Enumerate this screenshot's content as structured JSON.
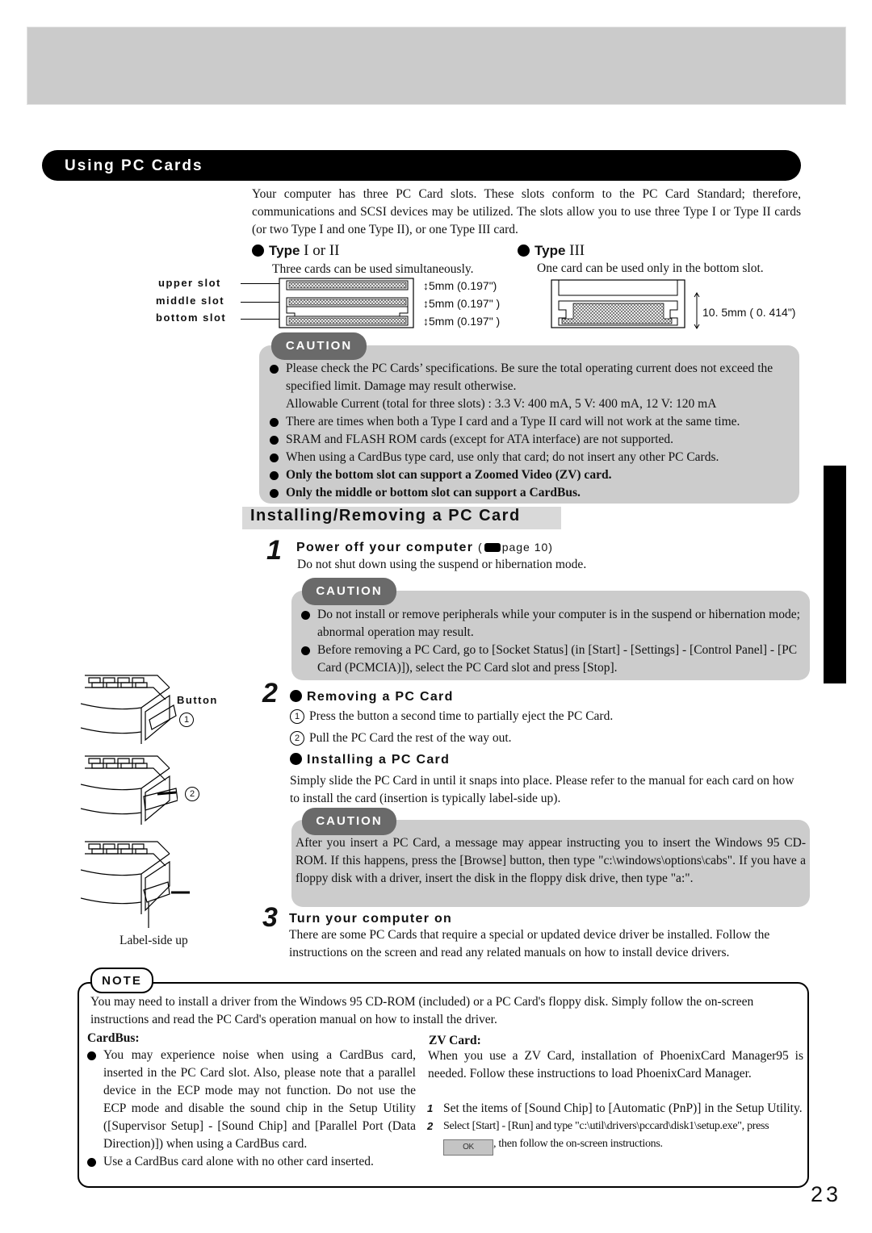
{
  "header": {
    "section_title": "Using PC Cards"
  },
  "intro": "Your computer has three PC Card slots.  These slots conform to the PC Card Standard; therefore, communications and SCSI devices may be utilized.  The slots allow you to use three Type I or Type II cards (or two Type I and one Type II), or one Type III card.",
  "types": {
    "type12": {
      "label": "Type ",
      "roman": "I or II",
      "desc": "Three cards can be used simultaneously."
    },
    "type3": {
      "label": "Type ",
      "roman": "III",
      "desc": "One card can be used only in the bottom slot."
    }
  },
  "diagram": {
    "slots": [
      "upper slot",
      "middle slot",
      "bottom slot"
    ],
    "dims": [
      "5mm (0.197\")",
      "5mm (0.197\" )",
      "5mm (0.197\" )"
    ],
    "type3_dim": "10. 5mm ( 0. 414\")"
  },
  "caution1": {
    "label": "CAUTION",
    "items": [
      {
        "text": "Please check the PC Cards’ specifications.  Be sure the total operating current does not exceed the specified limit.  Damage may result otherwise.",
        "bold": false,
        "bullet": true
      },
      {
        "text": "Allowable Current (total for three slots) : 3.3 V: 400 mA, 5 V: 400 mA, 12 V: 120 mA",
        "bold": false,
        "bullet": false
      },
      {
        "text": "There are times when both a Type I card and a Type II card will not work at the same time.",
        "bold": false,
        "bullet": true
      },
      {
        "text": "SRAM and FLASH ROM cards (except for ATA interface) are not supported.",
        "bold": false,
        "bullet": true
      },
      {
        "text": "When using a CardBus type card, use only that card; do not insert any other PC Cards.",
        "bold": false,
        "bullet": true
      },
      {
        "text": "Only the bottom slot can support a Zoomed Video (ZV) card.",
        "bold": true,
        "bullet": true
      },
      {
        "text": "Only the middle or bottom slot can support a CardBus.",
        "bold": true,
        "bullet": true
      }
    ]
  },
  "subsection": {
    "title": "Installing/Removing a PC Card"
  },
  "steps": {
    "s1": {
      "num": "1",
      "title": "Power off your computer",
      "ref_open": "(",
      "ref_page": "page 10)",
      "body": "Do not shut down using the suspend or hibernation mode."
    },
    "caution2": {
      "label": "CAUTION",
      "items": [
        "Do not install or remove peripherals while your computer is in the suspend or hibernation mode; abnormal operation may result.",
        "Before removing a PC Card, go to [Socket Status] (in [Start] - [Settings] - [Control Panel] - [PC Card (PCMCIA)]), select the PC Card slot and press [Stop]."
      ]
    },
    "s2": {
      "num": "2",
      "removing_title": "Removing a PC Card",
      "removing_steps": [
        {
          "n": "1",
          "text": "Press the button a second time to partially eject the PC Card."
        },
        {
          "n": "2",
          "text": "Pull the PC Card the rest of the way out."
        }
      ],
      "installing_title": "Installing a PC Card",
      "installing_body": "Simply slide the PC Card in until it snaps into place. Please refer to the manual for each card on how to install the card (insertion is typically label-side up)."
    },
    "caution3": {
      "label": "CAUTION",
      "text": "After you insert a PC Card, a message may appear instructing you to insert the Windows 95 CD-ROM. If this happens, press the [Browse] button, then type \"c:\\windows\\options\\cabs\". If you have a floppy disk with a driver, insert the disk in the floppy disk drive, then type \"a:\"."
    },
    "s3": {
      "num": "3",
      "title": "Turn your computer on",
      "body": "There are some PC Cards that require a special or updated device driver be installed. Follow the instructions on the screen and read any related manuals on how to install device drivers."
    }
  },
  "illustrations": {
    "button_label": "Button",
    "num1": "1",
    "num2": "2",
    "label_side": "Label-side up"
  },
  "note": {
    "label": "NOTE",
    "intro": "You may need to install a driver from the Windows 95 CD-ROM (included) or a PC Card's floppy disk. Simply follow the on-screen instructions and read the PC Card's operation manual on how to install the driver.",
    "cardbus": {
      "title": "CardBus:",
      "items": [
        "You may experience noise when using a CardBus card, inserted in the PC Card slot. Also, please note that a parallel device in the ECP mode may not function. Do not use the ECP mode and disable the sound chip in the Setup Utility ([Supervisor Setup] - [Sound Chip] and [Parallel Port (Data Direction)]) when using a CardBus card.",
        "Use a CardBus card alone with no other card inserted."
      ]
    },
    "zv": {
      "title": "ZV Card:",
      "intro": "When you use a ZV Card, installation of  PhoenixCard Manager95 is needed. Follow these instructions to load PhoenixCard Manager.",
      "steps": [
        {
          "n": "1",
          "text": "Set the items of  [Sound Chip] to [Automatic (PnP)] in the Setup Utility."
        },
        {
          "n": "2",
          "text_before": "Select [Start] - [Run] and type \"c:\\util\\drivers\\pccard\\disk1\\setup.exe\", press ",
          "ok_label": "OK",
          "text_after": ", then follow the on-screen instructions."
        }
      ]
    }
  },
  "footer": {
    "page_number": "23"
  }
}
